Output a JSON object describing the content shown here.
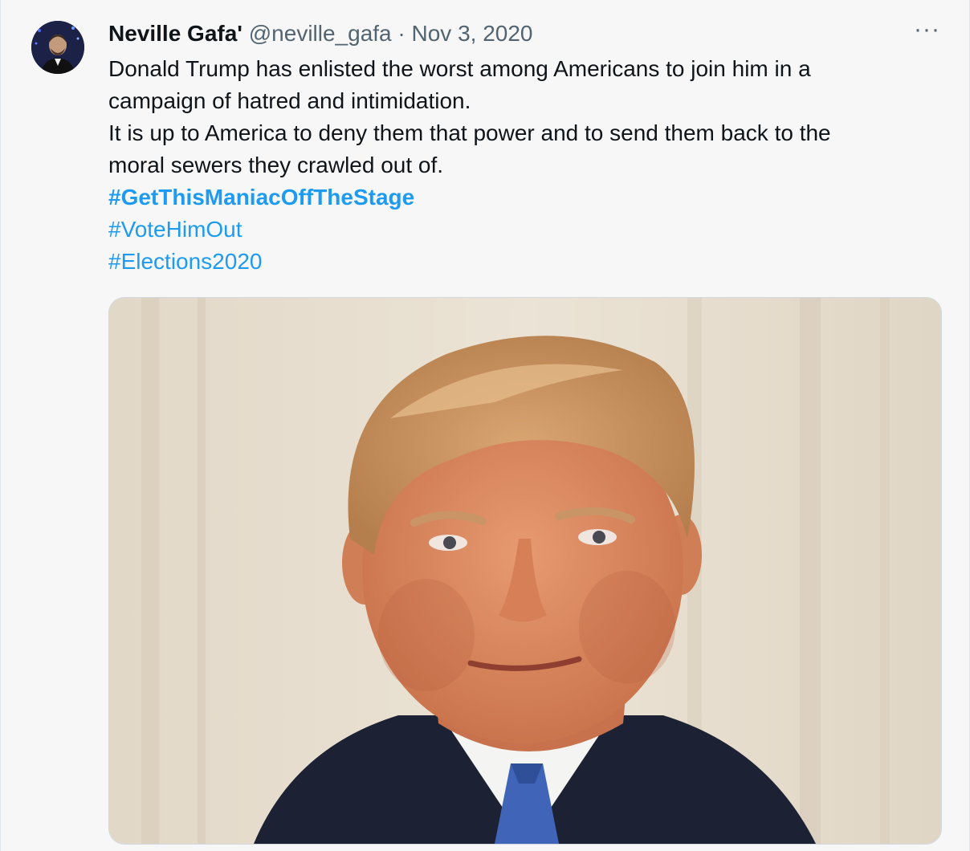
{
  "tweet": {
    "author_name": "Neville Gafa'",
    "handle": "@neville_gafa",
    "separator": "·",
    "date": "Nov 3, 2020",
    "more_label": "···",
    "text_lines": [
      "Donald Trump has enlisted the worst among Americans to join him in a",
      "campaign of hatred and intimidation.",
      "It is up to America to deny them that power and to send them back to the",
      "moral sewers they crawled out of."
    ],
    "hashtags": [
      "#GetThisManiacOffTheStage",
      "#VoteHimOut",
      "#Elections2020"
    ]
  },
  "colors": {
    "link": "#1d9bf0",
    "secondary_text": "#536471",
    "primary_text": "#0f1419"
  }
}
